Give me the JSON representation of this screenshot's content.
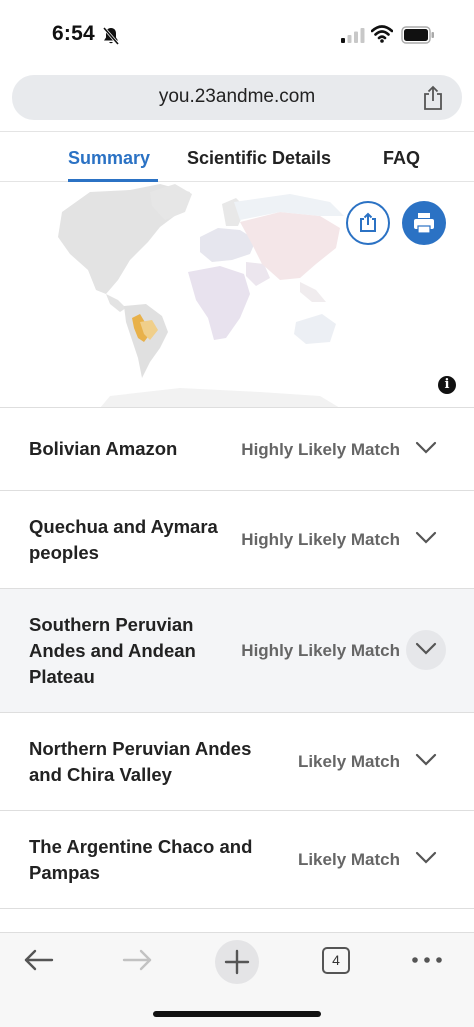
{
  "status_bar": {
    "time": "6:54",
    "icons": [
      "bell-slash-icon",
      "cellular-signal-icon",
      "wifi-icon",
      "battery-icon"
    ]
  },
  "address_bar": {
    "url": "you.23andme.com",
    "icon": "share-icon"
  },
  "tabs": [
    {
      "label": "Summary",
      "active": true
    },
    {
      "label": "Scientific Details",
      "active": false
    },
    {
      "label": "FAQ",
      "active": false
    }
  ],
  "map": {
    "buttons": [
      "share-icon",
      "print-icon"
    ],
    "info_icon_glyph": "i",
    "colors": {
      "land": "#e3e3e3",
      "highlight": "#e8b14a",
      "accent": "#2b72c4"
    }
  },
  "results": [
    {
      "name": "Bolivian Amazon",
      "match": "Highly Likely Match"
    },
    {
      "name": "Quechua and Aymara peoples",
      "match": "Highly Likely Match"
    },
    {
      "name": "Southern Peruvian Andes and Andean Plateau",
      "match": "Highly Likely Match"
    },
    {
      "name": "Northern Peruvian Andes and Chira Valley",
      "match": "Likely Match"
    },
    {
      "name": "The Argentine Chaco and Pampas",
      "match": "Likely Match"
    }
  ],
  "toolbar": {
    "tab_count": "4",
    "icons": [
      "back-arrow-icon",
      "forward-arrow-icon",
      "plus-icon",
      "tabs-icon",
      "more-icon"
    ]
  }
}
